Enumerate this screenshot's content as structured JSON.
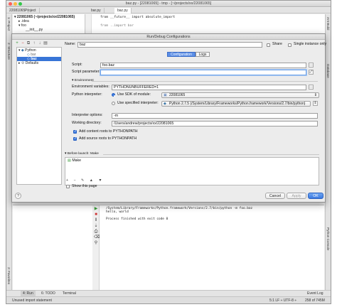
{
  "ide": {
    "window_title": "baz.py - [22081065] - tmp - [~/projects/xx/22081065]",
    "tabs": [
      "22081065",
      "Project",
      "bar.py",
      "baz.py"
    ],
    "project_tree": [
      "▾ 22081065 (~/projects/xx/22081065)",
      "▸ .idea",
      "▾ foo",
      "__init__.py"
    ],
    "code_lines": [
      "from __future__ import absolute_import",
      "",
      "from ..import bar"
    ],
    "left_strip": [
      "1: Project",
      "2: Structure"
    ],
    "left_strip_bottom": [
      "2: Favorites"
    ],
    "right_strip": [
      "Ant Build",
      "Database",
      "Python Console"
    ],
    "console_lines": [
      "/System/Library/Frameworks/Python.framework/Versions/2.7/bin/python -m foo.baz",
      "hello, world",
      "",
      "Process finished with exit code 0"
    ],
    "bottom_tools": [
      "4: Run",
      "6: TODO",
      "Terminal",
      "Event Log"
    ],
    "status_left": "Unused import statement",
    "status_right": "5:1   LF ÷   UTF-8 ÷",
    "memory": "258 of 745M"
  },
  "dialog": {
    "title": "Run/Debug Configurations",
    "toolbar": [
      "+",
      "−",
      "⧉",
      "↑",
      "↓",
      "▤"
    ],
    "tree": {
      "python": "Python",
      "bar": "bar",
      "baz": "baz",
      "defaults": "Defaults"
    },
    "name_label": "Name:",
    "name_value": "baz",
    "share_label": "Share",
    "single_instance_label": "Single instance only",
    "tabs": [
      "Configuration",
      "Logs"
    ],
    "script_label": "Script:",
    "script_value": "foo.baz",
    "script_params_label": "Script parameters:",
    "script_params_value": "",
    "environment_section": "Environment",
    "env_vars_label": "Environment variables:",
    "env_vars_value": "PYTHONUNBUFFERED=1",
    "interpreter_label": "Python interpreter:",
    "use_sdk_label": "Use SDK of module:",
    "sdk_value": "22081065",
    "use_specified_label": "Use specified interpreter:",
    "specified_value": "Python 2.7.5 (/System/Library/Frameworks/Python.framework/Versions/2.7/bin/python)",
    "interp_options_label": "Interpreter options:",
    "interp_options_value": "-m",
    "workdir_label": "Working directory:",
    "workdir_value": "/Users/andrew/projects/xx/22081065",
    "add_content_label": "Add content roots to PYTHONPATH",
    "add_source_label": "Add source roots to PYTHONPATH",
    "before_launch_label": "Before launch: Make",
    "before_launch_item": "Make",
    "before_launch_tools": [
      "+",
      "−",
      "✎",
      "▲",
      "▼"
    ],
    "show_page_label": "Show this page",
    "cancel_label": "Cancel",
    "apply_label": "Apply",
    "ok_label": "OK",
    "help_label": "?"
  },
  "colors": {
    "selection": "#3875d7",
    "primary_button": "#3a79e0",
    "traffic_red": "#fc605c",
    "traffic_yellow": "#fdbc40",
    "traffic_green": "#34c84a"
  }
}
